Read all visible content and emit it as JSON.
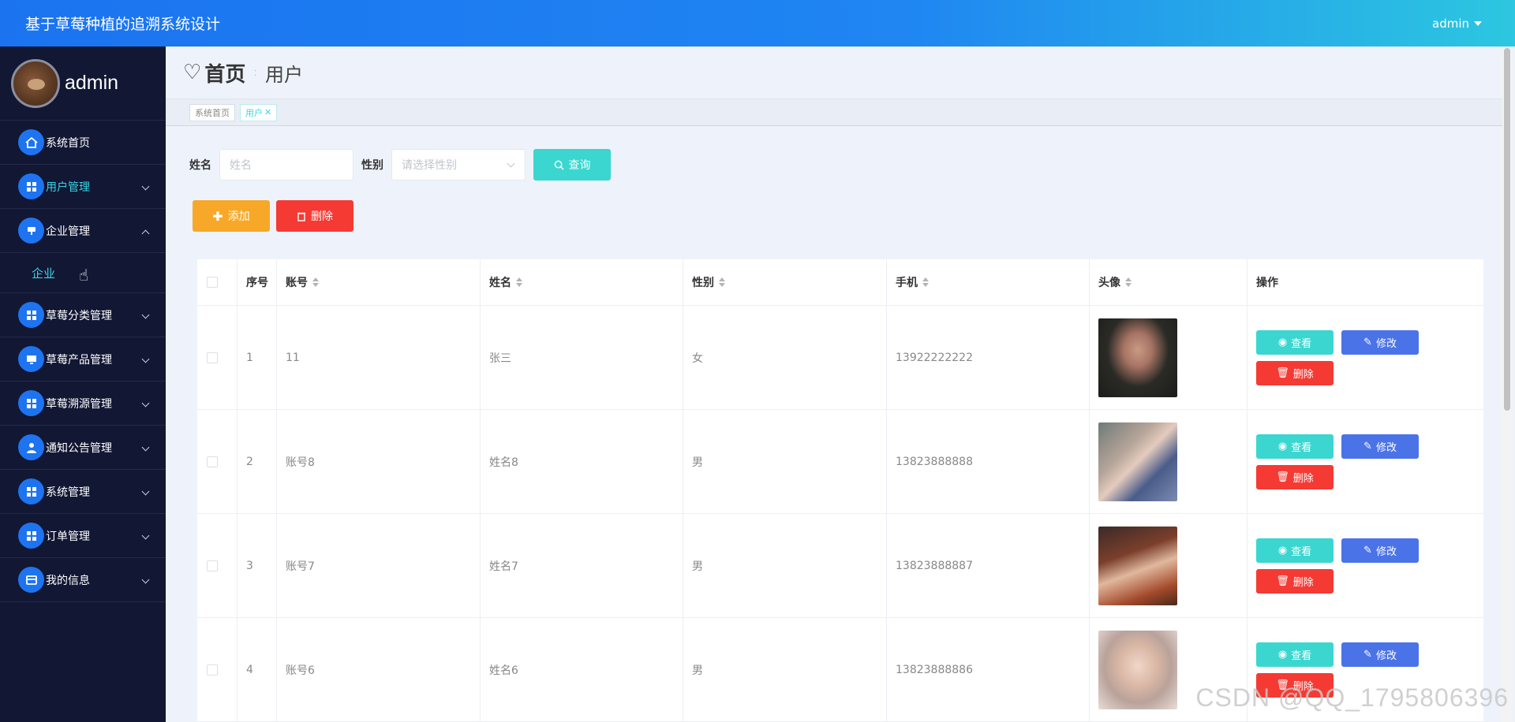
{
  "header": {
    "title": "基于草莓种植的追溯系统设计",
    "user": "admin"
  },
  "sidebar": {
    "profile_name": "admin",
    "items": [
      {
        "label": "系统首页",
        "icon": "home-icon",
        "expanded": false
      },
      {
        "label": "用户管理",
        "icon": "grid-icon",
        "expanded": false,
        "active": true
      },
      {
        "label": "企业管理",
        "icon": "cup-icon",
        "expanded": true
      },
      {
        "label": "草莓分类管理",
        "icon": "grid-icon",
        "expanded": false
      },
      {
        "label": "草莓产品管理",
        "icon": "monitor-icon",
        "expanded": false
      },
      {
        "label": "草莓溯源管理",
        "icon": "grid-icon",
        "expanded": false
      },
      {
        "label": "通知公告管理",
        "icon": "user-icon",
        "expanded": false
      },
      {
        "label": "系统管理",
        "icon": "grid-icon",
        "expanded": false
      },
      {
        "label": "订单管理",
        "icon": "grid-icon",
        "expanded": false
      },
      {
        "label": "我的信息",
        "icon": "card-icon",
        "expanded": false
      }
    ],
    "submenu": {
      "label": "企业"
    }
  },
  "page": {
    "breadcrumb_home": "首页",
    "breadcrumb_current": "用户",
    "tags": [
      {
        "label": "系统首页"
      },
      {
        "label": "用户"
      }
    ]
  },
  "search": {
    "name_label": "姓名",
    "name_placeholder": "姓名",
    "gender_label": "性别",
    "gender_placeholder": "请选择性别",
    "search_button": "查询"
  },
  "actions": {
    "add": "添加",
    "delete": "删除"
  },
  "table": {
    "columns": [
      "序号",
      "账号",
      "姓名",
      "性别",
      "手机",
      "头像",
      "操作"
    ],
    "rows": [
      {
        "index": "1",
        "account": "11",
        "name": "张三",
        "gender": "女",
        "phone": "13922222222"
      },
      {
        "index": "2",
        "account": "账号8",
        "name": "姓名8",
        "gender": "男",
        "phone": "13823888888"
      },
      {
        "index": "3",
        "account": "账号7",
        "name": "姓名7",
        "gender": "男",
        "phone": "13823888887"
      },
      {
        "index": "4",
        "account": "账号6",
        "name": "姓名6",
        "gender": "男",
        "phone": "13823888886"
      }
    ],
    "ops": {
      "view": "查看",
      "edit": "修改",
      "delete": "删除"
    }
  },
  "watermark": "CSDN @QQ_1795806396",
  "colors": {
    "header_start": "#1b73f0",
    "header_end": "#2cc7e0",
    "sidebar": "#121734",
    "accent": "#3bd4e5",
    "edit": "#4b73e8",
    "danger": "#f53a34",
    "warning": "#f8a828"
  }
}
